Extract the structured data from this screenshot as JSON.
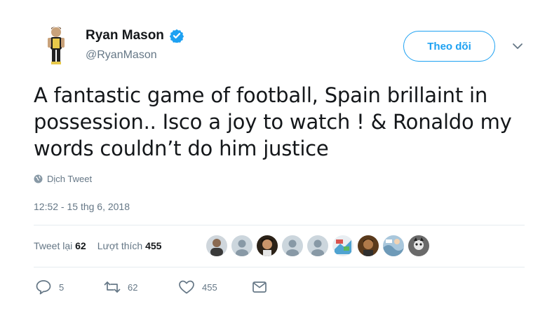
{
  "user": {
    "display_name": "Ryan Mason",
    "handle": "@RyanMason",
    "verified": true
  },
  "follow_button": {
    "label": "Theo dõi"
  },
  "tweet": {
    "text": "A fantastic game of football, Spain brillaint in possession.. Isco a joy to watch ! & Ronaldo my words couldn’t do him justice",
    "translate_label": "Dịch Tweet",
    "timestamp": "12:52 - 15 thg 6, 2018"
  },
  "stats": {
    "retweets_label": "Tweet lại",
    "retweets": "62",
    "likes_label": "Lượt thích",
    "likes": "455"
  },
  "actions": {
    "reply_count": "5",
    "retweet_count": "62",
    "like_count": "455"
  },
  "colors": {
    "accent": "#1da1f2",
    "muted": "#657786",
    "text": "#14171a",
    "divider": "#e6ecf0"
  },
  "icons": [
    "verified-badge-icon",
    "chevron-down-icon",
    "globe-icon",
    "reply-icon",
    "retweet-icon",
    "heart-icon",
    "message-icon"
  ]
}
